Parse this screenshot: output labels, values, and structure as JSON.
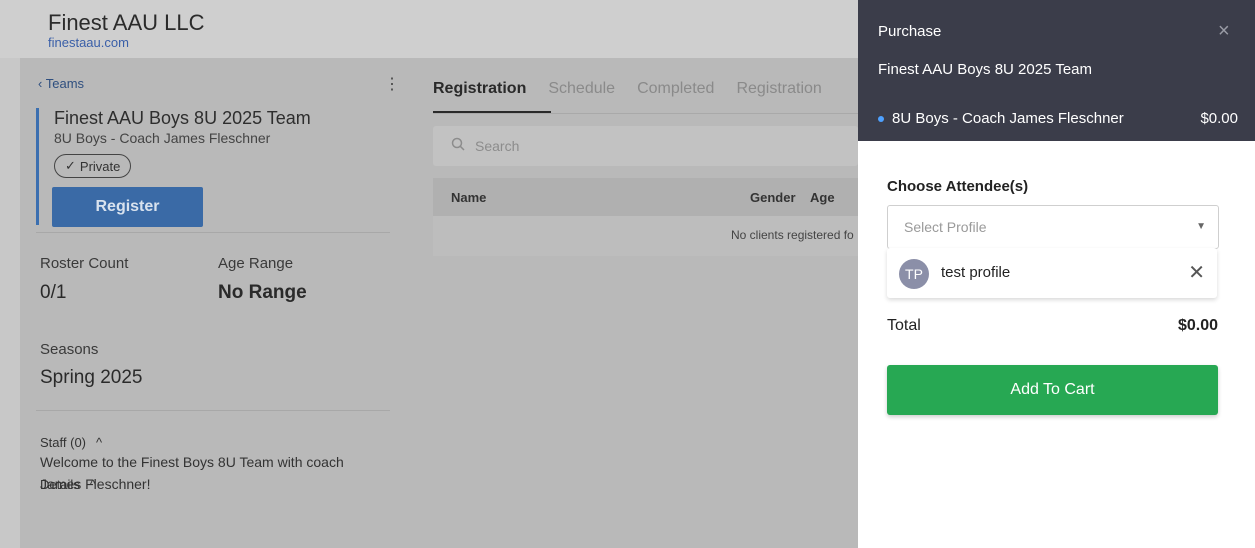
{
  "header": {
    "brand_name": "Finest AAU LLC",
    "brand_url": "finestaau.com"
  },
  "sidebar": {
    "back_label": "Teams",
    "kebab": "⋮",
    "team_title": "Finest AAU Boys 8U 2025 Team",
    "team_subtitle": "8U Boys - Coach James Fleschner",
    "private_label": "Private",
    "register_label": "Register",
    "roster_count_label": "Roster Count",
    "roster_count_value": "0/1",
    "age_range_label": "Age Range",
    "age_range_value": "No Range",
    "seasons_label": "Seasons",
    "seasons_value": "Spring 2025",
    "staff_label": "Staff (0)",
    "details_label": "Details",
    "details_text": "Welcome to the Finest Boys 8U Team with coach James Fleschner!"
  },
  "content": {
    "tabs": [
      {
        "label": "Registration"
      },
      {
        "label": "Schedule"
      },
      {
        "label": "Completed"
      },
      {
        "label": "Registration"
      }
    ],
    "search_placeholder": "Search",
    "columns": {
      "name": "Name",
      "gender": "Gender",
      "age": "Age"
    },
    "empty_message": "No clients registered fo"
  },
  "drawer": {
    "title": "Purchase",
    "close": "×",
    "team_name": "Finest AAU Boys 8U 2025 Team",
    "line_item": "8U Boys - Coach James Fleschner",
    "line_price": "$0.00",
    "attendee_label": "Choose Attendee(s)",
    "select_placeholder": "Select Profile",
    "attendee": {
      "initials": "TP",
      "name": "test profile"
    },
    "total_label": "Total",
    "total_value": "$0.00",
    "add_to_cart_label": "Add To Cart"
  },
  "colors": {
    "accent_blue": "#3a6aa6",
    "drawer_header": "#3b3d4a",
    "cart_green": "#27a853",
    "status_dot": "#4ea1ff"
  }
}
